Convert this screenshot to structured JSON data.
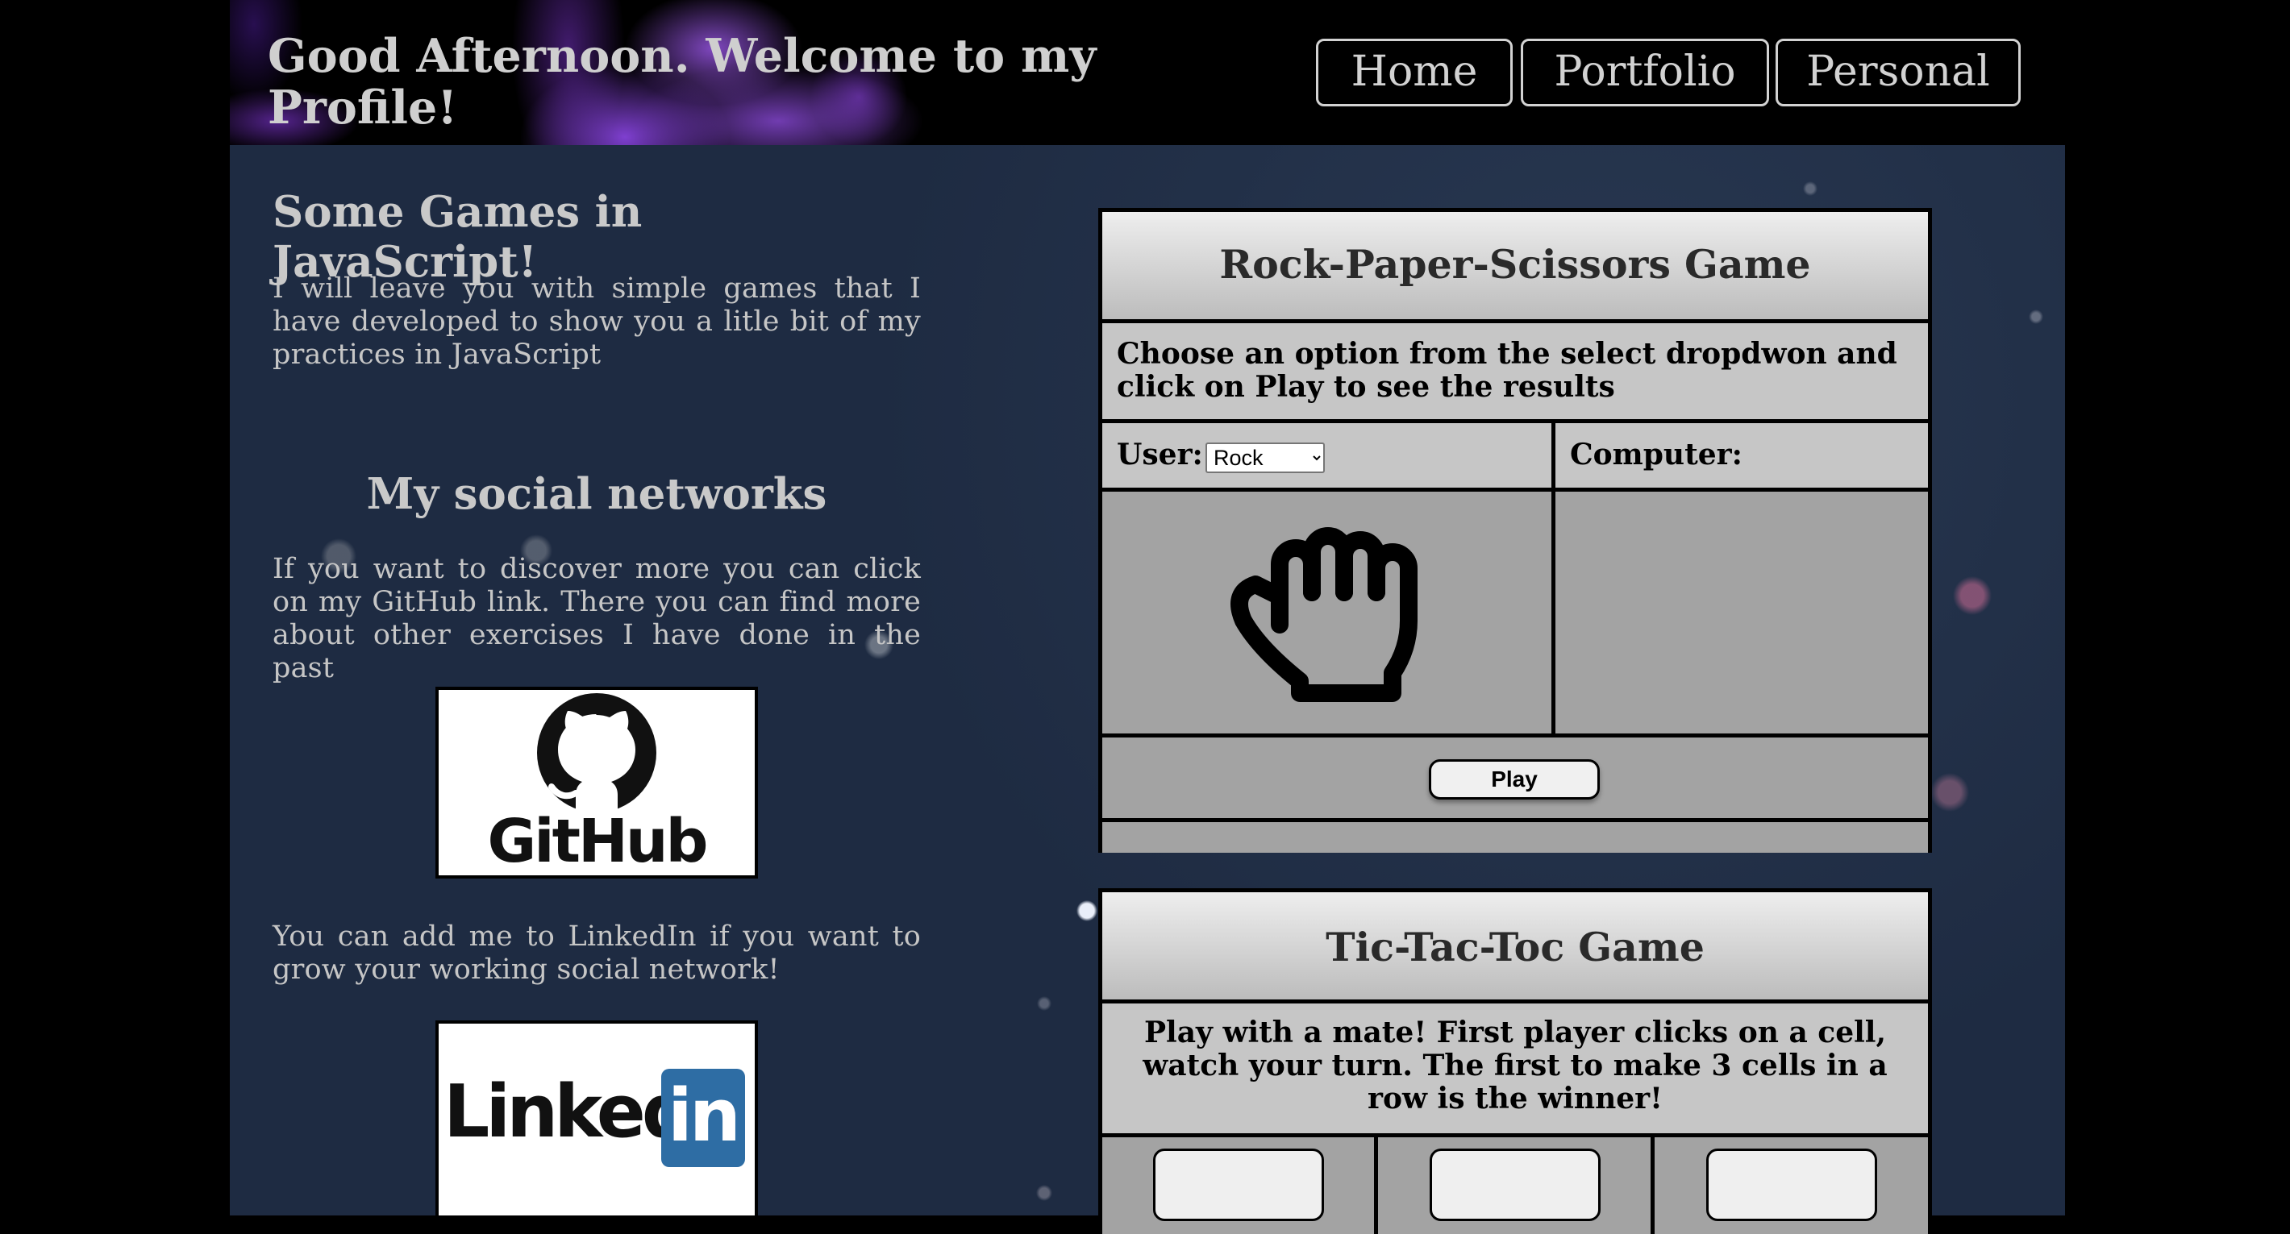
{
  "header": {
    "greeting": "Good Afternoon. Welcome to my Profile!",
    "nav": [
      "Home",
      "Portfolio",
      "Personal"
    ]
  },
  "games_section": {
    "title": "Some Games in JavaScript!",
    "text": "I will leave you with simple games that I have developed to show you a litle bit of my practices in JavaScript"
  },
  "social": {
    "title": "My social networks",
    "github_text": "If you want to discover more you can click on my GitHub link. There you can find more about other exercises I have done in the past",
    "github_logo": "GitHub",
    "linkedin_text": "You can add me to LinkedIn if you want to grow your working social network!",
    "linkedin_logo_left": "Linked",
    "linkedin_logo_right": "in"
  },
  "rps": {
    "title": "Rock-Paper-Scissors Game",
    "description": "Choose an option from the select dropdwon and click on Play to see the results",
    "user_label": "User:",
    "selected": "Rock",
    "computer_label": "Computer:",
    "user_icon": "fist-icon",
    "play_label": "Play"
  },
  "ttt": {
    "title": "Tic-Tac-Toc Game",
    "description": "Play with a mate! First player clicks on a cell, watch your turn. The first to make 3 cells in a row is the winner!"
  },
  "colors": {
    "page_bg": "#1e2b42",
    "text": "#c9c9c9",
    "panel_gray": "#a3a3a3",
    "linkedin_blue": "#2e6da4"
  }
}
